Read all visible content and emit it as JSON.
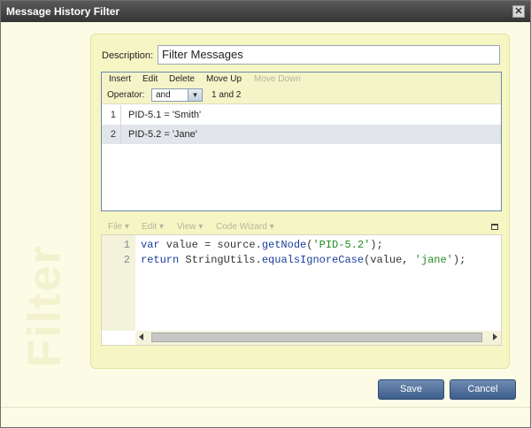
{
  "window": {
    "title": "Message History Filter",
    "close_glyph": "✕"
  },
  "side_label": "Filter",
  "description": {
    "label": "Description:",
    "value": "Filter Messages"
  },
  "toolbar": {
    "insert": "Insert",
    "edit": "Edit",
    "delete": "Delete",
    "move_up": "Move Up",
    "move_down": "Move Down"
  },
  "operator": {
    "label": "Operator:",
    "value": "and",
    "expression": "1 and 2"
  },
  "rules": [
    {
      "num": "1",
      "text": "PID-5.1 = 'Smith'"
    },
    {
      "num": "2",
      "text": "PID-5.2 = 'Jane'"
    }
  ],
  "editor_menu": {
    "file": "File ▾",
    "edit": "Edit ▾",
    "view": "View ▾",
    "code_wizard": "Code Wizard ▾"
  },
  "code": {
    "line_numbers": [
      "1",
      "2"
    ],
    "line1": {
      "kw": "var",
      "rest1": " value = source.",
      "fn": "getNode",
      "rest2": "(",
      "str": "'PID-5.2'",
      "rest3": ");"
    },
    "line2": {
      "kw": "return",
      "rest1": " StringUtils.",
      "fn": "equalsIgnoreCase",
      "rest2": "(value, ",
      "str": "'jane'",
      "rest3": ");"
    }
  },
  "buttons": {
    "save": "Save",
    "cancel": "Cancel"
  },
  "colors": {
    "accent": "#4a6a98",
    "panel": "#f6f6c4",
    "selected_row": "#e2e5ea"
  }
}
